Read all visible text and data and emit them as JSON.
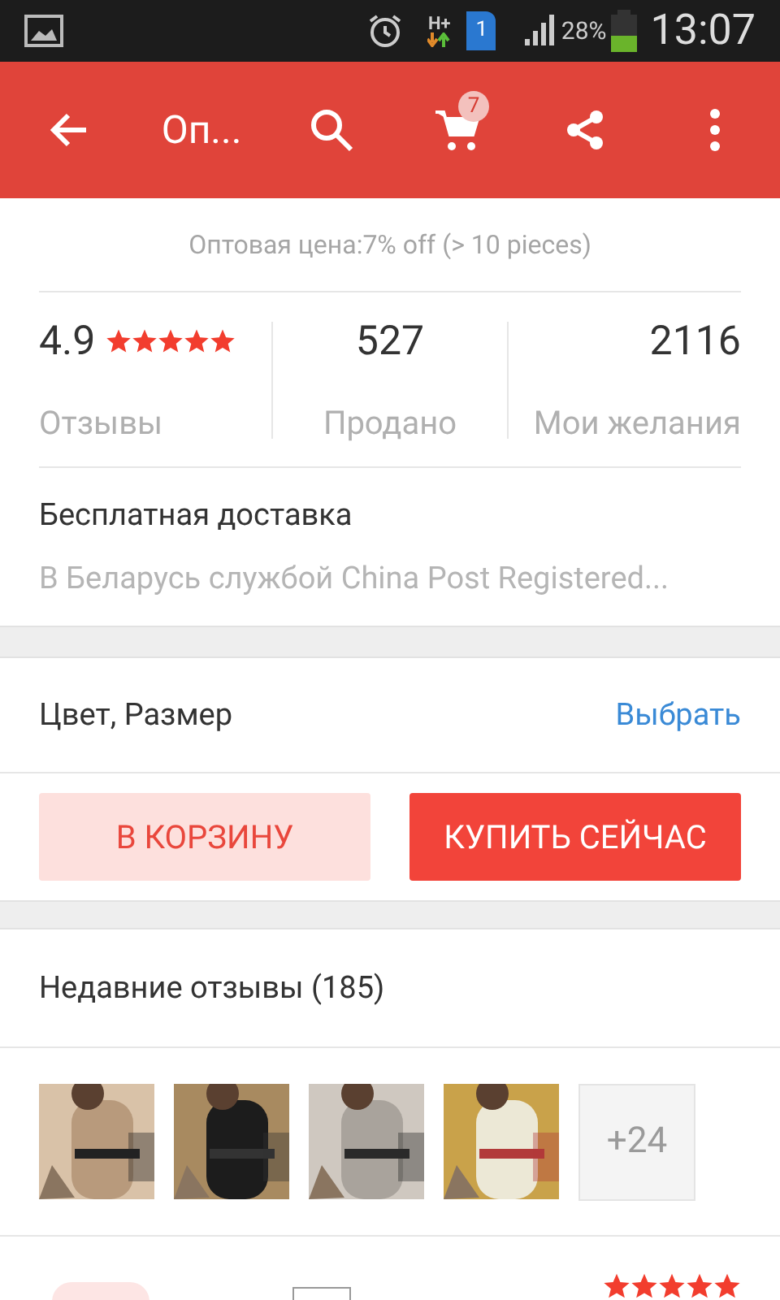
{
  "status_bar": {
    "battery_text": "28%",
    "time": "13:07",
    "sim": "1",
    "network": "H+"
  },
  "toolbar": {
    "title": "Оп...",
    "cart_count": "7"
  },
  "wholesale": "Оптовая цена:7% off (> 10 pieces)",
  "stats": [
    {
      "value": "4.9",
      "label": "Отзывы",
      "stars": 5
    },
    {
      "value": "527",
      "label": "Продано"
    },
    {
      "value": "2116",
      "label": "Мои желания"
    }
  ],
  "delivery": {
    "title": "Бесплатная доставка",
    "detail": "В Беларусь службой China Post Registered..."
  },
  "options": {
    "label": "Цвет, Размер",
    "action": "Выбрать"
  },
  "buttons": [
    {
      "label": "В КОРЗИНУ",
      "kind": "secondary"
    },
    {
      "label": "КУПИТЬ СЕЙЧАС",
      "kind": "primary"
    }
  ],
  "reviews": {
    "title": "Недавние отзывы (185)",
    "more": "+24",
    "first_review": {
      "stars": 5
    }
  }
}
